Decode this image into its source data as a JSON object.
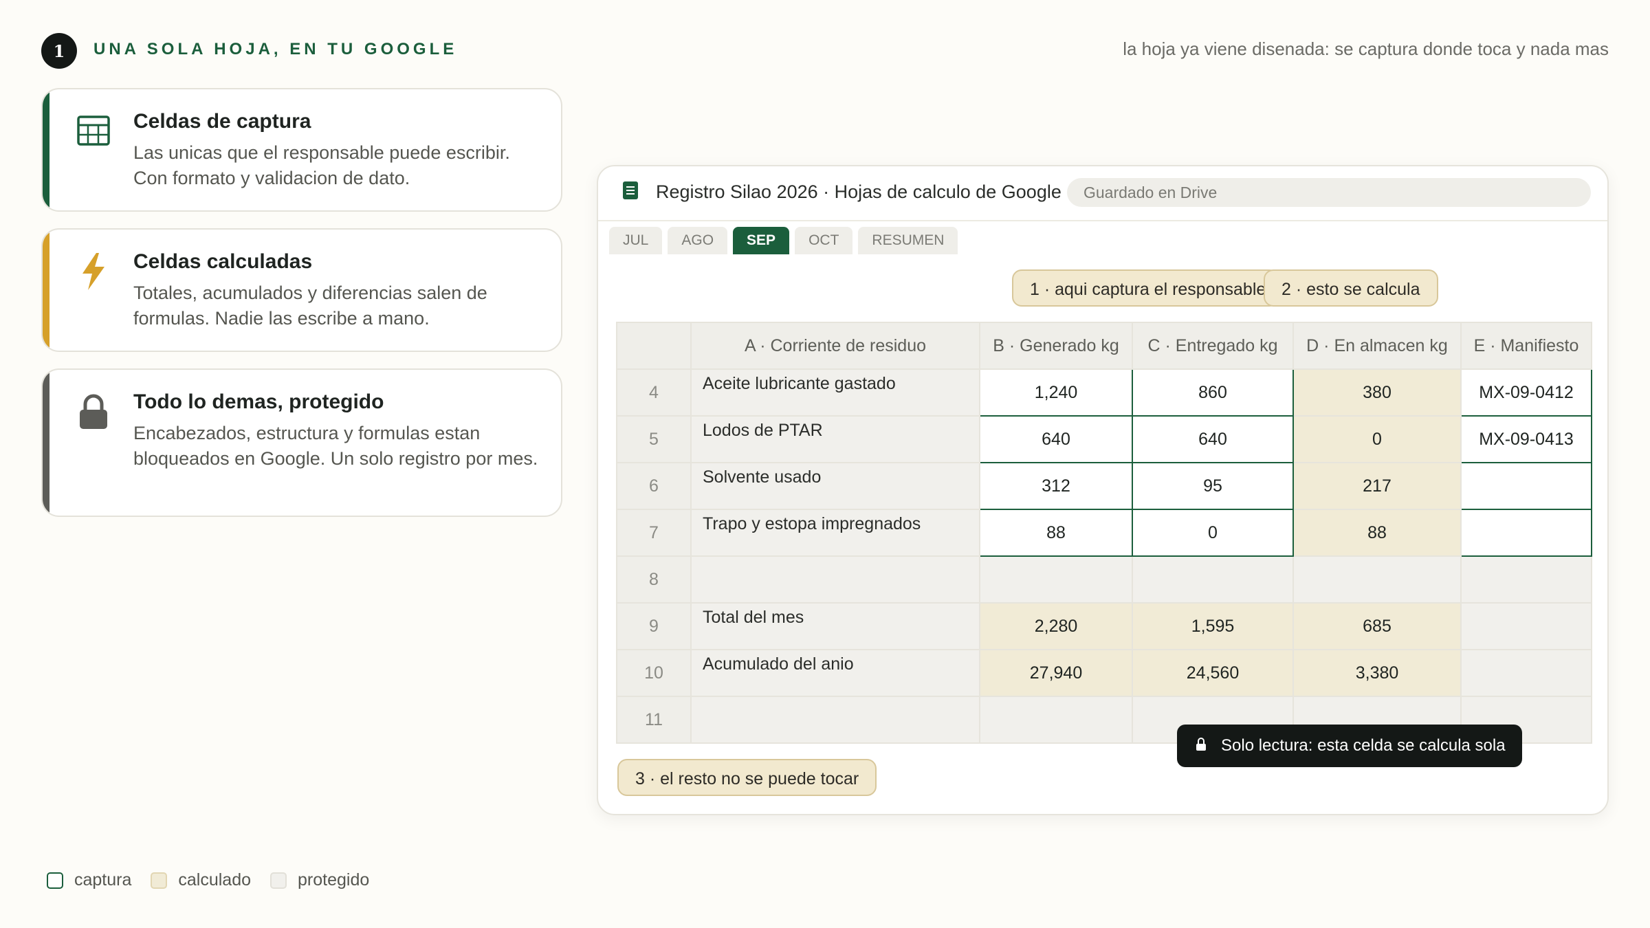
{
  "header": {
    "step": "1",
    "title": "UNA SOLA HOJA, EN TU GOOGLE",
    "tagline": "la hoja ya viene disenada: se captura donde toca y nada mas"
  },
  "cards": [
    {
      "title": "Celdas de captura",
      "desc": "Las unicas que el responsable puede escribir. Con formato y validacion de dato.",
      "icon": "grid-icon",
      "accent": "#1b5e3c"
    },
    {
      "title": "Celdas calculadas",
      "desc": "Totales, acumulados y diferencias salen de formulas. Nadie las escribe a mano.",
      "icon": "lightning-icon",
      "accent": "#d6a02a"
    },
    {
      "title": "Todo lo demas, protegido",
      "desc": "Encabezados, estructura y formulas estan bloqueados en Google. Un solo registro por mes.",
      "icon": "lock-icon",
      "accent": "#5c5c58"
    }
  ],
  "sheet": {
    "title": "Registro Silao 2026 · Hojas de calculo de Google",
    "saved": "Guardado en Drive",
    "tabs": [
      "JUL",
      "AGO",
      "SEP",
      "OCT",
      "RESUMEN"
    ],
    "active_tab": "SEP",
    "callouts": {
      "capture": "1 · aqui captura el responsable",
      "calculated": "2 · esto se calcula",
      "protected": "3 · el resto no se puede tocar"
    },
    "columns": [
      "A · Corriente de residuo",
      "B · Generado kg",
      "C · Entregado kg",
      "D · En almacen kg",
      "E · Manifiesto"
    ],
    "rows": [
      {
        "num": "4",
        "name": "Aceite lubricante gastado",
        "b": "1,240",
        "c": "860",
        "d": "380",
        "e": "MX-09-0412"
      },
      {
        "num": "5",
        "name": "Lodos de PTAR",
        "b": "640",
        "c": "640",
        "d": "0",
        "e": "MX-09-0413"
      },
      {
        "num": "6",
        "name": "Solvente usado",
        "b": "312",
        "c": "95",
        "d": "217",
        "e": ""
      },
      {
        "num": "7",
        "name": "Trapo y estopa impregnados",
        "b": "88",
        "c": "0",
        "d": "88",
        "e": ""
      },
      {
        "num": "8",
        "name": "",
        "b": "",
        "c": "",
        "d": "",
        "e": ""
      },
      {
        "num": "9",
        "name": "Total del mes",
        "b": "2,280",
        "c": "1,595",
        "d": "685",
        "e": ""
      },
      {
        "num": "10",
        "name": "Acumulado del anio",
        "b": "27,940",
        "c": "24,560",
        "d": "3,380",
        "e": ""
      },
      {
        "num": "11",
        "name": "",
        "b": "",
        "c": "",
        "d": "",
        "e": ""
      }
    ],
    "tooltip": "Solo lectura: esta celda se calcula sola"
  },
  "legend": {
    "capture": "captura",
    "calculated": "calculado",
    "protected": "protegido"
  },
  "colors": {
    "accent_green": "#1b5e3c",
    "accent_yellow": "#d6a02a",
    "calc_fill": "#f1ebd6",
    "protected_fill": "#f1f0ec"
  }
}
